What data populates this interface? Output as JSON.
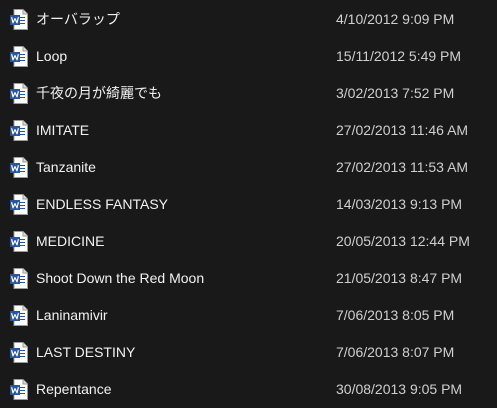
{
  "file_icon": "word-document-icon",
  "colors": {
    "background": "#191919",
    "name_text": "#f2f2f2",
    "date_text": "#cfcfcf",
    "icon_blue": "#2b579a"
  },
  "files": [
    {
      "name": "オーバラップ",
      "modified": "4/10/2012 9:09 PM"
    },
    {
      "name": "Loop",
      "modified": "15/11/2012 5:49 PM"
    },
    {
      "name": "千夜の月が綺麗でも",
      "modified": "3/02/2013 7:52 PM"
    },
    {
      "name": "IMITATE",
      "modified": "27/02/2013 11:46 AM"
    },
    {
      "name": "Tanzanite",
      "modified": "27/02/2013 11:53 AM"
    },
    {
      "name": "ENDLESS FANTASY",
      "modified": "14/03/2013 9:13 PM"
    },
    {
      "name": "MEDICINE",
      "modified": "20/05/2013 12:44 PM"
    },
    {
      "name": "Shoot Down the Red Moon",
      "modified": "21/05/2013 8:47 PM"
    },
    {
      "name": "Laninamivir",
      "modified": "7/06/2013 8:05 PM"
    },
    {
      "name": "LAST DESTINY",
      "modified": "7/06/2013 8:07 PM"
    },
    {
      "name": "Repentance",
      "modified": "30/08/2013 9:05 PM"
    }
  ]
}
